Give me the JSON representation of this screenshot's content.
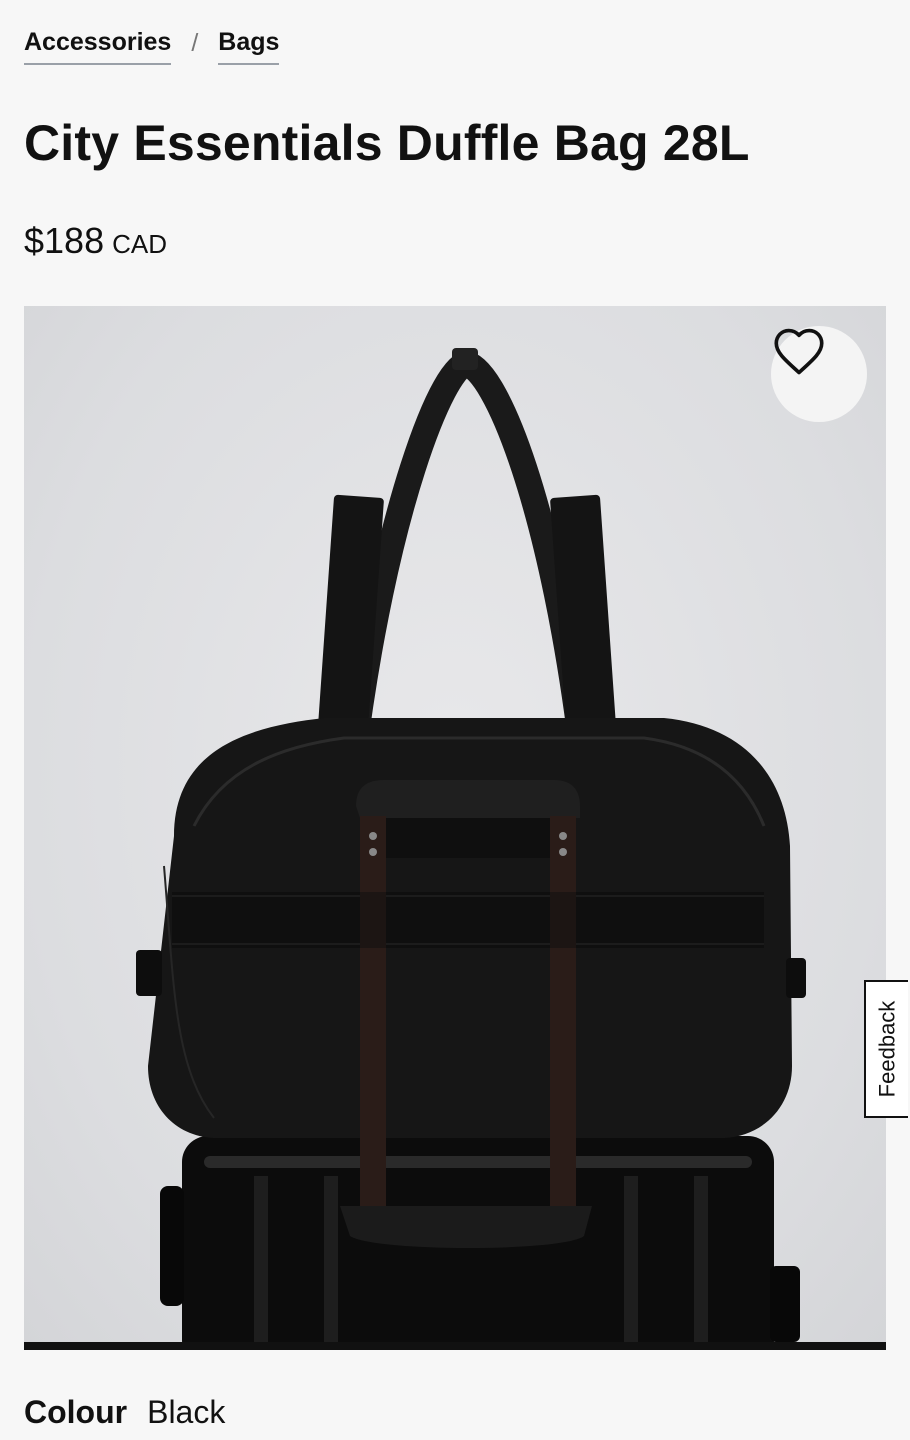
{
  "breadcrumb": {
    "items": [
      {
        "label": "Accessories"
      },
      {
        "label": "Bags"
      }
    ],
    "separator": "/"
  },
  "product": {
    "title": "City Essentials Duffle Bag 28L",
    "price": "$188",
    "currency": "CAD"
  },
  "gallery": {
    "wishlist_icon": "heart-icon",
    "progress": 1.0
  },
  "feedback": {
    "label": "Feedback"
  },
  "colour": {
    "label": "Colour",
    "value": "Black"
  },
  "colors": {
    "background": "#f7f7f7",
    "text": "#111111",
    "bag": "#161616"
  }
}
